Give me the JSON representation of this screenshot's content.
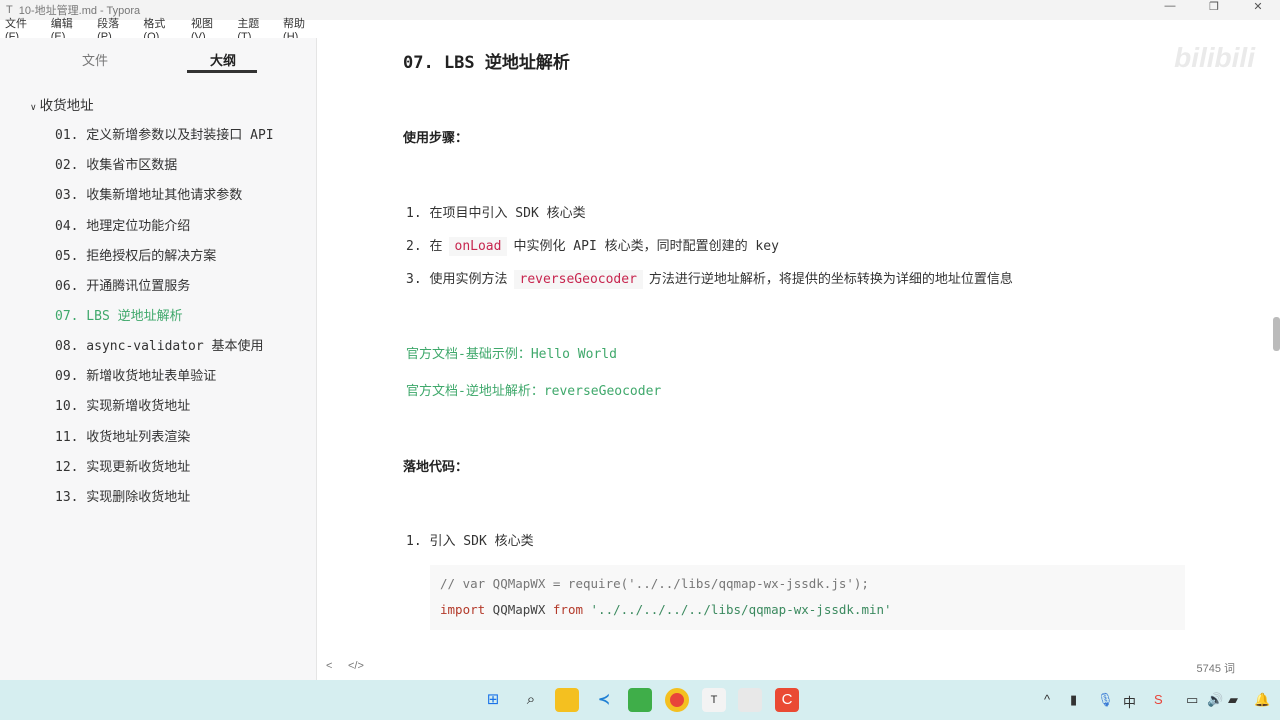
{
  "window": {
    "title": "10-地址管理.md - Typora",
    "app_icon": "T",
    "minimize": "—",
    "restore": "❐",
    "close": "✕"
  },
  "menu": [
    "文件(F)",
    "编辑(E)",
    "段落(P)",
    "格式(O)",
    "视图(V)",
    "主题(T)",
    "帮助(H)"
  ],
  "sidebar": {
    "tabs": [
      "文件",
      "大纲"
    ],
    "root": "收货地址",
    "items": [
      "01. 定义新增参数以及封装接口 API",
      "02. 收集省市区数据",
      "03. 收集新增地址其他请求参数",
      "04. 地理定位功能介绍",
      "05. 拒绝授权后的解决方案",
      "06. 开通腾讯位置服务",
      "07. LBS 逆地址解析",
      "08. async-validator 基本使用",
      "09. 新增收货地址表单验证",
      "10. 实现新增收货地址",
      "11. 收货地址列表渲染",
      "12. 实现更新收货地址",
      "13. 实现删除收货地址"
    ]
  },
  "doc": {
    "heading": "07. LBS 逆地址解析",
    "steps_title": "使用步骤：",
    "steps": [
      {
        "num": "1.",
        "pre": "在项目中引入 SDK 核心类"
      },
      {
        "num": "2.",
        "pre": "在",
        "code": "onLoad",
        "post": "中实例化 API 核心类，同时配置创建的 key"
      },
      {
        "num": "3.",
        "pre": "使用实例方法",
        "code": "reverseGeocoder",
        "post": "方法进行逆地址解析，将提供的坐标转换为详细的地址位置信息"
      }
    ],
    "links": [
      "官方文档-基础示例：Hello World",
      "官方文档-逆地址解析：reverseGeocoder"
    ],
    "code_title": "落地代码：",
    "code_step": {
      "num": "1.",
      "text": "引入 SDK 核心类"
    },
    "code": {
      "line1": "// var QQMapWX = require('../../libs/qqmap-wx-jssdk.js');",
      "kw1": "import",
      "id": " QQMapWX ",
      "kw2": "from",
      "str": " '../../../../../libs/qqmap-wx-jssdk.min'"
    }
  },
  "footer": {
    "back": "<",
    "source": "</>",
    "word_count": "5745 词"
  },
  "watermark": "bilibili"
}
